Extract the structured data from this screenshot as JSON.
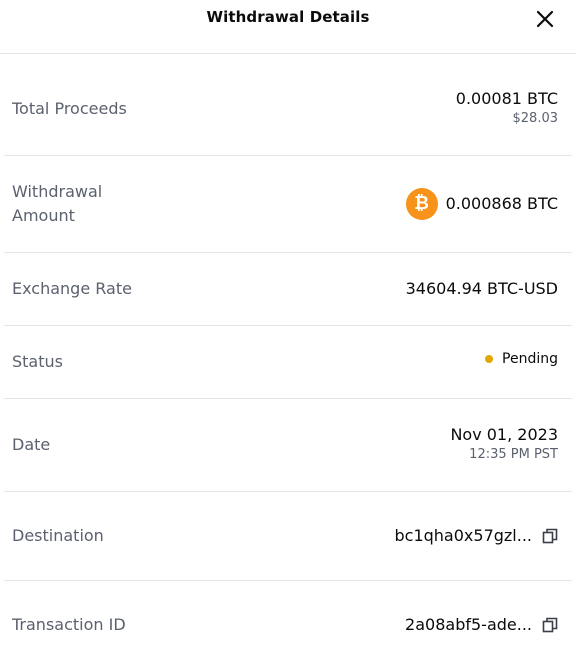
{
  "header": {
    "title": "Withdrawal Details",
    "close_icon": "close-icon"
  },
  "rows": {
    "total_proceeds": {
      "label": "Total Proceeds",
      "value": "0.00081 BTC",
      "sub": "$28.03"
    },
    "withdrawal_amount": {
      "label_line1": "Withdrawal",
      "label_line2": "Amount",
      "coin_icon": "bitcoin-icon",
      "coin_symbol": "₿",
      "value": "0.000868 BTC"
    },
    "exchange_rate": {
      "label": "Exchange Rate",
      "value": "34604.94 BTC-USD"
    },
    "status": {
      "label": "Status",
      "value": "Pending",
      "dot_color": "#e0a800"
    },
    "date": {
      "label": "Date",
      "value": "Nov 01, 2023",
      "sub": "12:35 PM PST"
    },
    "destination": {
      "label": "Destination",
      "value": "bc1qha0x57gzl...",
      "copy_icon": "copy-icon"
    },
    "transaction_id": {
      "label": "Transaction ID",
      "value": "2a08abf5-ade...",
      "copy_icon": "copy-icon"
    }
  },
  "colors": {
    "bitcoin_orange": "#f7931a",
    "label_gray": "#5b616e",
    "divider": "#e3e5e8"
  }
}
